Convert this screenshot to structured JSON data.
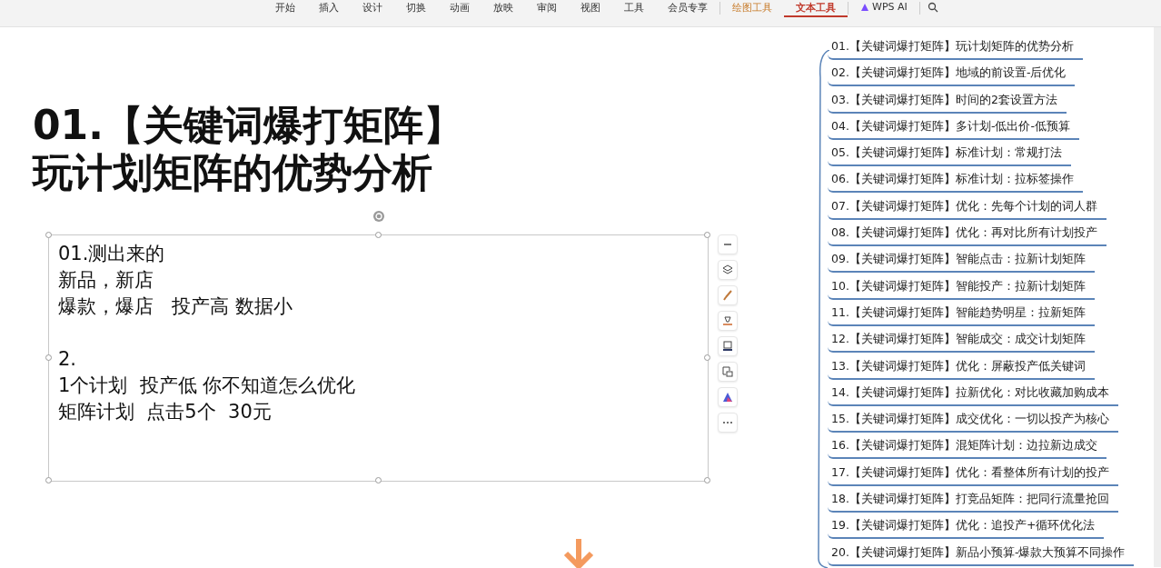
{
  "ribbon": {
    "tabs": [
      {
        "label": "开始",
        "selected": false
      },
      {
        "label": "插入",
        "selected": false
      },
      {
        "label": "设计",
        "selected": false
      },
      {
        "label": "切换",
        "selected": false
      },
      {
        "label": "动画",
        "selected": false
      },
      {
        "label": "放映",
        "selected": false
      },
      {
        "label": "审阅",
        "selected": false
      },
      {
        "label": "视图",
        "selected": false
      },
      {
        "label": "工具",
        "selected": false
      },
      {
        "label": "会员专享",
        "selected": false
      },
      {
        "label": "绘图工具",
        "selected": false,
        "kind": "context"
      },
      {
        "label": "文本工具",
        "selected": true,
        "kind": "context"
      },
      {
        "label": "WPS AI",
        "selected": false,
        "kind": "ai"
      }
    ]
  },
  "slide": {
    "title_lines": [
      "01.【关键词爆打矩阵】",
      "玩计划矩阵的优势分析"
    ],
    "text_box": {
      "paragraphs": [
        [
          "01.测出来的",
          "新品，新店",
          "爆款，爆店   投产高 数据小"
        ],
        [
          "2.",
          "1个计划  投产低 你不知道怎么优化",
          "矩阵计划  点击5个  30元"
        ]
      ]
    }
  },
  "outline": {
    "items": [
      "01.【关键词爆打矩阵】玩计划矩阵的优势分析",
      "02.【关键词爆打矩阵】地域的前设置-后优化",
      "03.【关键词爆打矩阵】时间的2套设置方法",
      "04.【关键词爆打矩阵】多计划-低出价-低预算",
      "05.【关键词爆打矩阵】标准计划：常规打法",
      "06.【关键词爆打矩阵】标准计划：拉标签操作",
      "07.【关键词爆打矩阵】优化：先每个计划的词人群",
      "08.【关键词爆打矩阵】优化：再对比所有计划投产",
      "09.【关键词爆打矩阵】智能点击：拉新计划矩阵",
      "10.【关键词爆打矩阵】智能投产：拉新计划矩阵",
      "11.【关键词爆打矩阵】智能趋势明星：拉新矩阵",
      "12.【关键词爆打矩阵】智能成交：成交计划矩阵",
      "13.【关键词爆打矩阵】优化：屏蔽投产低关键词",
      "14.【关键词爆打矩阵】拉新优化：对比收藏加购成本",
      "15.【关键词爆打矩阵】成交优化：一切以投产为核心",
      "16.【关键词爆打矩阵】混矩阵计划：边拉新边成交",
      "17.【关键词爆打矩阵】优化：看整体所有计划的投产",
      "18.【关键词爆打矩阵】打竞品矩阵：把同行流量抢回",
      "19.【关键词爆打矩阵】优化：追投产+循环优化法",
      "20.【关键词爆打矩阵】新品小预算-爆款大预算不同操作"
    ]
  }
}
